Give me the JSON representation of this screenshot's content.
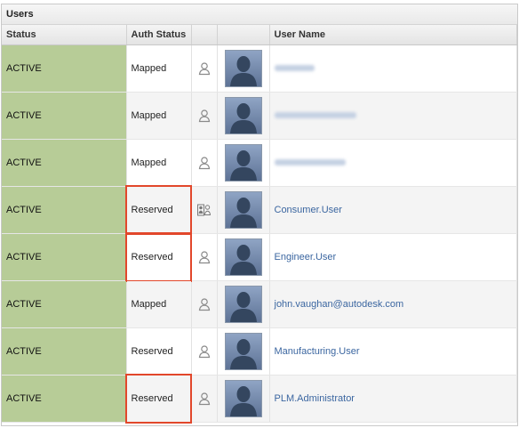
{
  "panel": {
    "title": "Users"
  },
  "columns": {
    "status": "Status",
    "auth_status": "Auth Status",
    "icon": "",
    "photo": "",
    "user_name": "User Name"
  },
  "rows": [
    {
      "status": "ACTIVE",
      "auth_status": "Mapped",
      "icon": "user-icon",
      "user_name": "",
      "name_obscured": true,
      "highlighted": false
    },
    {
      "status": "ACTIVE",
      "auth_status": "Mapped",
      "icon": "user-icon",
      "user_name": "",
      "name_obscured": true,
      "highlighted": false
    },
    {
      "status": "ACTIVE",
      "auth_status": "Mapped",
      "icon": "user-icon",
      "user_name": "",
      "name_obscured": true,
      "highlighted": false
    },
    {
      "status": "ACTIVE",
      "auth_status": "Reserved",
      "icon": "user-group-icon",
      "user_name": "Consumer.User",
      "name_obscured": false,
      "highlighted": true
    },
    {
      "status": "ACTIVE",
      "auth_status": "Reserved",
      "icon": "user-icon",
      "user_name": "Engineer.User",
      "name_obscured": false,
      "highlighted": true
    },
    {
      "status": "ACTIVE",
      "auth_status": "Mapped",
      "icon": "user-icon",
      "user_name": "john.vaughan@autodesk.com",
      "name_obscured": false,
      "highlighted": false
    },
    {
      "status": "ACTIVE",
      "auth_status": "Reserved",
      "icon": "user-icon",
      "user_name": "Manufacturing.User",
      "name_obscured": false,
      "highlighted": false
    },
    {
      "status": "ACTIVE",
      "auth_status": "Reserved",
      "icon": "user-icon",
      "user_name": "PLM.Administrator",
      "name_obscured": false,
      "highlighted": true
    }
  ],
  "colors": {
    "status_cell": "#b7cc97",
    "highlight_border": "#e2472b",
    "user_name_link": "#3b66a0"
  }
}
